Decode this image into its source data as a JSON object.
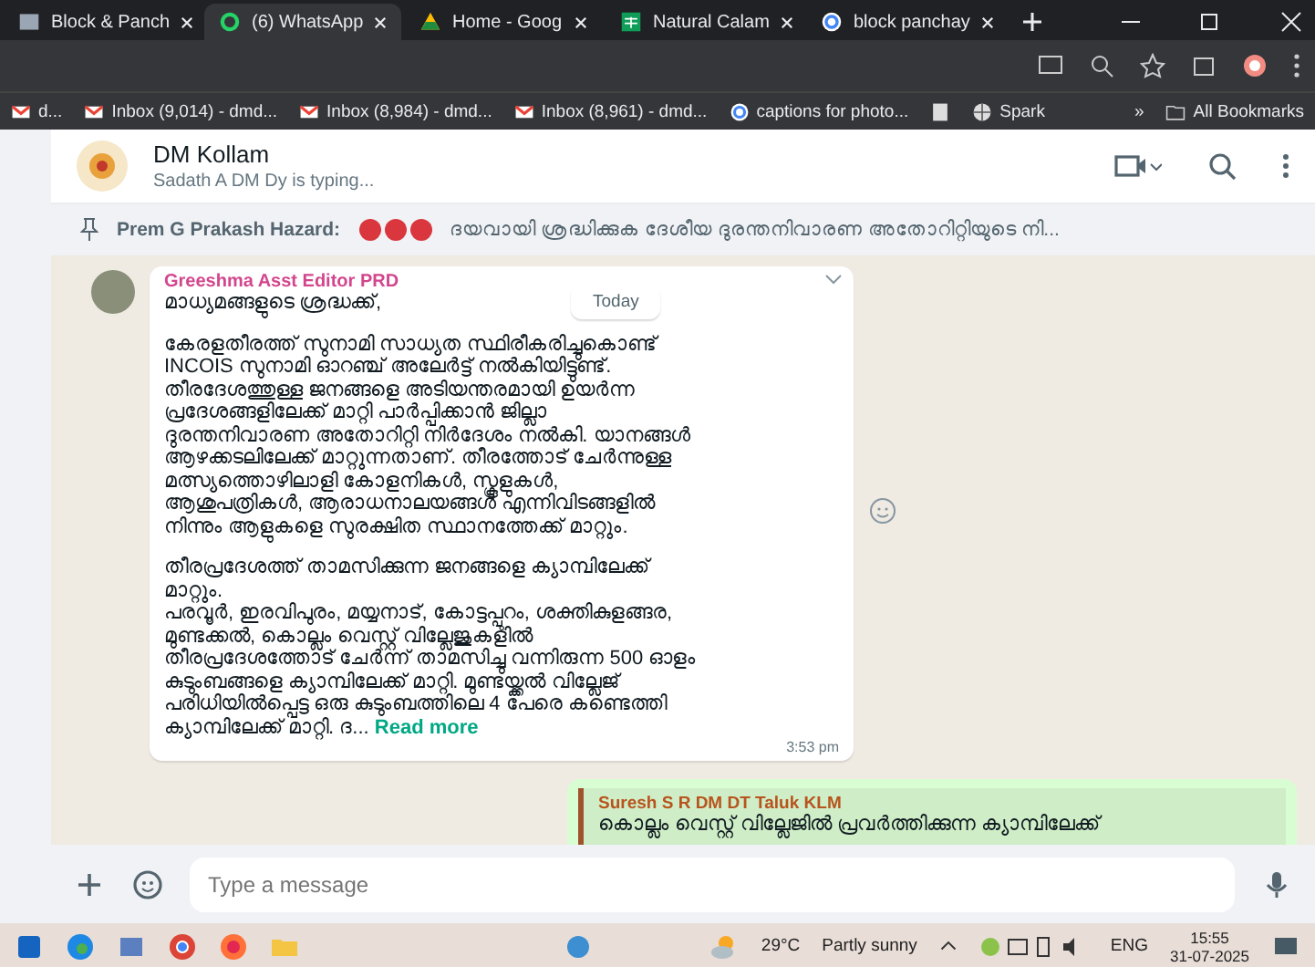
{
  "browser": {
    "tabs": [
      {
        "label": "Block & Panch",
        "selected": false,
        "kind": "doc"
      },
      {
        "label": "(6) WhatsApp",
        "selected": true,
        "kind": "chat"
      },
      {
        "label": "Home - Goog",
        "selected": false,
        "kind": "drive"
      },
      {
        "label": "Natural Calam",
        "selected": false,
        "kind": "sheet"
      },
      {
        "label": "block panchay",
        "selected": false,
        "kind": "google"
      }
    ],
    "bookmarks": [
      {
        "label": "d...",
        "kind": "mail"
      },
      {
        "label": "Inbox (9,014) - dmd...",
        "kind": "mail"
      },
      {
        "label": "Inbox (8,984) - dmd...",
        "kind": "mail"
      },
      {
        "label": "Inbox (8,961) - dmd...",
        "kind": "mail"
      },
      {
        "label": "captions for photo...",
        "kind": "google"
      },
      {
        "kind": "page"
      },
      {
        "label": "Spark",
        "kind": "globe"
      }
    ],
    "more": "»",
    "all_bookmarks": "All Bookmarks"
  },
  "chat": {
    "title": "DM Kollam",
    "status": "Sadath A DM Dy is typing...",
    "pinned": {
      "sender": "Prem G Prakash Hazard:",
      "text": "ദയവായി ശ്രദ്ധിക്കുക  ദേശീയ ദുരന്തനിവാരണ അതോറിറ്റിയുടെ നി..."
    },
    "date_chip": "Today",
    "message": {
      "sender": "Greeshma Asst Editor PRD",
      "paragraphs": [
        "മാധ്യമങ്ങളുടെ ശ്രദ്ധക്ക്,",
        "കേരളതീരത്ത് സുനാമി സാധ്യത സ്ഥിരീകരിച്ചുകൊണ്ട്\nINCOIS സുനാമി ഓറഞ്ച് അലേർട്ട് നൽകിയിട്ടുണ്ട്.\nതീരദേശത്തുള്ള ജനങ്ങളെ അടിയന്തരമായി  ഉയർന്ന\nപ്രദേശങ്ങളിലേക്ക് മാറ്റി പാർപ്പിക്കാൻ ജില്ലാ\nദുരന്തനിവാരണ അതോറിറ്റി നിർദേശം നൽകി. യാനങ്ങൾ\nആഴക്കടലിലേക്ക് മാറ്റുന്നതാണ്. തീരത്തോട് ചേർന്നുള്ള\nമത്സ്യത്തൊഴിലാളി കോളനികൾ, സ്കൂളുകൾ,\nആശുപത്രികൾ, ആരാധനാലയങ്ങൾ എന്നിവിടങ്ങളിൽ\nനിന്നും ആളുകളെ സുരക്ഷിത സ്ഥാനത്തേക്ക് മാറ്റും.",
        "തീരപ്രദേശത്ത് താമസിക്കുന്ന ജനങ്ങളെ ക്യാമ്പിലേക്ക്\nമാറ്റും.\nപരവൂർ, ഇരവിപുരം, മയ്യനാട്, കോട്ടപ്പുറം, ശക്തികുളങ്ങര,\nമുണ്ടക്കൽ, കൊല്ലം വെസ്റ്റ് വില്ലേജുകളിൽ\nതീരപ്രദേശത്തോട് ചേർന്ന് താമസിച്ചു വന്നിരുന്ന 500 ഓളം\nകുടുംബങ്ങളെ ക്യാമ്പിലേക്ക് മാറ്റി. മുണ്ടയ്ക്കൽ വില്ലേജ്\nപരിധിയിൽപ്പെട്ട ഒരു കുടുംബത്തിലെ 4 പേരെ കണ്ടെത്തി\nക്യാമ്പിലേക്ക് മാറ്റി.   ദ..."
      ],
      "read_more": "Read more",
      "time": "3:53 pm"
    },
    "reply": {
      "sender": "Suresh S R DM DT Taluk KLM",
      "text": "കൊല്ലം വെസ്റ്റ് വില്ലേജിൽ പ്രവർത്തിക്കുന്ന ക്യാമ്പിലേക്ക്"
    },
    "composer": {
      "placeholder": "Type a message"
    }
  },
  "taskbar": {
    "temperature": "29°C",
    "weather": "Partly sunny",
    "language": "ENG",
    "time": "15:55",
    "date": "31-07-2025"
  }
}
